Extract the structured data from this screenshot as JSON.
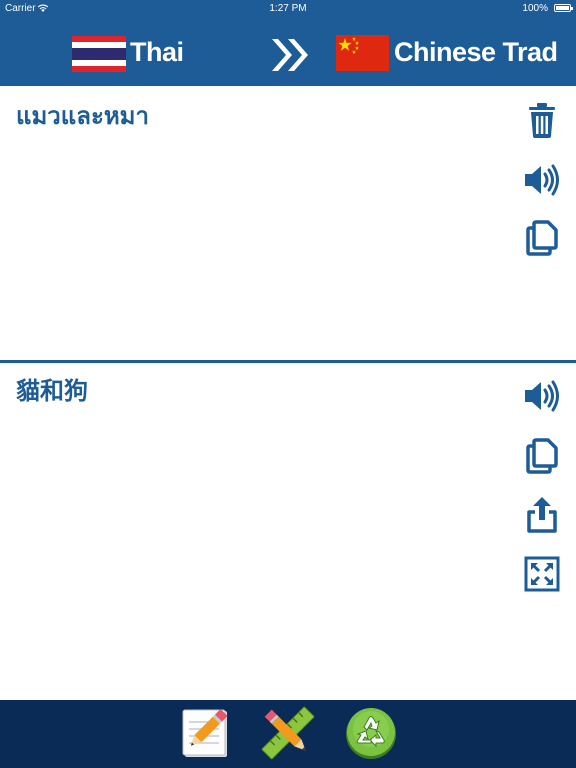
{
  "status_bar": {
    "carrier": "Carrier",
    "time": "1:27 PM",
    "battery": "100%"
  },
  "header": {
    "source_language": "Thai",
    "target_language": "Chinese Trad",
    "source_flag": "thailand-flag",
    "target_flag": "china-flag",
    "swap_icon": "double-chevron-right-icon"
  },
  "source_panel": {
    "text": "แมวและหมา",
    "actions": [
      "trash-icon",
      "speaker-icon",
      "copy-icon"
    ]
  },
  "target_panel": {
    "text": "貓和狗",
    "actions": [
      "speaker-icon",
      "copy-icon",
      "share-icon",
      "fullscreen-icon"
    ]
  },
  "toolbar": {
    "tools": [
      "notepad-pencil-icon",
      "ruler-pencil-icon",
      "recycle-icon"
    ]
  },
  "colors": {
    "header_blue": "#1d5c97",
    "toolbar_navy": "#0a2b56",
    "icon_blue": "#1d5c97",
    "text_blue": "#1d5c97"
  }
}
